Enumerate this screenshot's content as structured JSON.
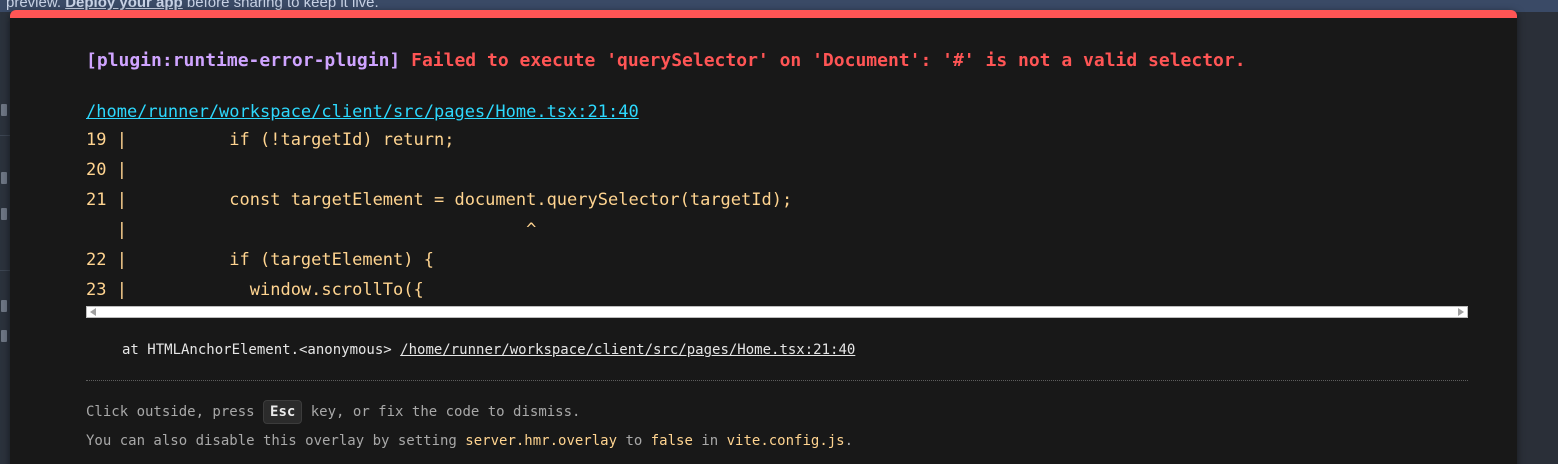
{
  "background": {
    "banner_prefix": "preview.",
    "banner_link": "Deploy your app",
    "banner_suffix": "before sharing to keep it live."
  },
  "error": {
    "plugin_label": "[plugin:runtime-error-plugin]",
    "message": "Failed to execute 'querySelector' on 'Document': '#' is not a valid selector.",
    "file_link": "/home/runner/workspace/client/src/pages/Home.tsx:21:40"
  },
  "code_frame": [
    "19 |          if (!targetId) return;",
    "20 |",
    "21 |          const targetElement = document.querySelector(targetId);",
    "   |                                       ^",
    "22 |          if (targetElement) {",
    "23 |            window.scrollTo({"
  ],
  "stack": {
    "prefix": "at HTMLAnchorElement.<anonymous>",
    "link": "/home/runner/workspace/client/src/pages/Home.tsx:21:40"
  },
  "tips": {
    "line1_before": "Click outside, press ",
    "line1_key": "Esc",
    "line1_after": " key, or fix the code to dismiss.",
    "line2_before": "You can also disable this overlay by setting ",
    "line2_code1": "server.hmr.overlay",
    "line2_mid": " to ",
    "line2_code2": "false",
    "line2_mid2": " in ",
    "line2_code3": "vite.config.js",
    "line2_end": "."
  },
  "colors": {
    "accent_red": "#ff5555",
    "plugin_purple": "#cfa4ff",
    "link_cyan": "#2dd9fe",
    "code_yellow": "#ffd490"
  }
}
